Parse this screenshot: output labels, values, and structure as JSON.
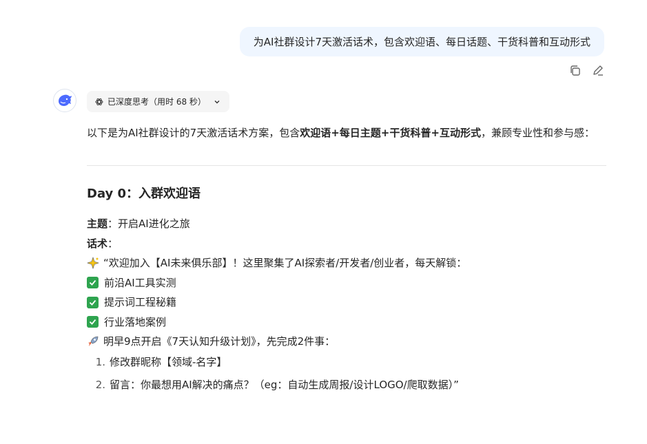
{
  "user_message": "为AI社群设计7天激活话术，包含欢迎语、每日话题、干货科普和互动形式",
  "message_actions": {
    "copy_icon": "copy-icon",
    "edit_icon": "edit-icon"
  },
  "think": {
    "icon": "atom-icon",
    "label": "已深度思考（用时 68 秒）",
    "chevron": "chevron-down-icon"
  },
  "answer": {
    "intro": {
      "prefix": "以下是为AI社群设计的7天激活话术方案，包含",
      "bold": "欢迎语+每日主题+干货科普+互动形式",
      "suffix": "，兼顾专业性和参与感："
    },
    "day0": {
      "title": "Day 0：入群欢迎语",
      "theme_label": "主题",
      "theme_value": "：开启AI进化之旅",
      "script_label": "话术",
      "script_colon": "：",
      "welcome_line": "“欢迎加入【AI未来俱乐部】！这里聚集了AI探索者/开发者/创业者，每天解锁：",
      "benefits": [
        "前沿AI工具实测",
        "提示词工程秘籍",
        "行业落地案例"
      ],
      "plan_line": "明早9点开启《7天认知升级计划》，先完成2件事：",
      "steps": [
        {
          "num": "1.",
          "text": "修改群昵称【领域-名字】"
        },
        {
          "num": "2.",
          "text": "留言：你最想用AI解决的痛点？（eg：自动生成周报/设计LOGO/爬取数据）”"
        }
      ]
    }
  },
  "colors": {
    "bubble": "#eff6ff",
    "check": "#2ea44f",
    "brand": "#4d6bfe"
  }
}
